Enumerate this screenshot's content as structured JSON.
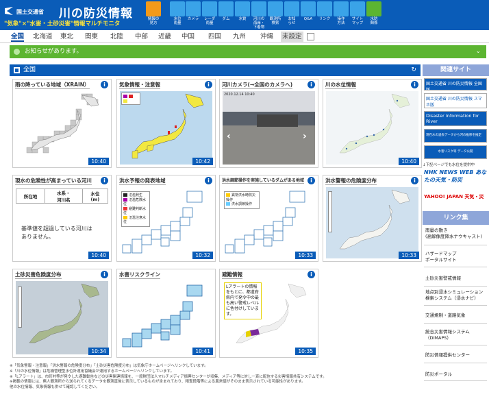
{
  "header": {
    "org": "国土交通省",
    "title": "川の防災情報",
    "subtitle": "\"気象\"×\"水害・土砂災害\"情報マルチモニタ",
    "icons": [
      {
        "name": "info-icon",
        "label": "情報の\n見方",
        "color": "#f39a1a"
      },
      {
        "name": "water-level-icon",
        "label": "水位\n雨量",
        "color": "#3aa3e8"
      },
      {
        "name": "camera-icon",
        "label": "カメラ",
        "color": "#3aa3e8"
      },
      {
        "name": "radar-icon",
        "label": "レーダ\n雨量",
        "color": "#3aa3e8"
      },
      {
        "name": "dam-icon",
        "label": "ダム",
        "color": "#3aa3e8"
      },
      {
        "name": "water-quality-icon",
        "label": "水質",
        "color": "#3aa3e8"
      },
      {
        "name": "river-search-icon",
        "label": "河川の\n海岸・\n下着物",
        "color": "#3aa3e8"
      },
      {
        "name": "observatory-icon",
        "label": "観測所\n検索",
        "color": "#3aa3e8"
      },
      {
        "name": "notice-icon",
        "label": "お知\nらせ",
        "color": "#3aa3e8"
      },
      {
        "name": "qa-icon",
        "label": "Q&A",
        "color": "#3aa3e8"
      },
      {
        "name": "link-icon",
        "label": "リンク",
        "color": "#3aa3e8"
      },
      {
        "name": "operation-icon",
        "label": "操作\n方法",
        "color": "#3aa3e8"
      },
      {
        "name": "sitemap-icon",
        "label": "サイト\nマップ",
        "color": "#3aa3e8"
      },
      {
        "name": "disaster-icon",
        "label": "水防\n関係",
        "color": "#5cb531"
      }
    ]
  },
  "regions": [
    "全国",
    "北海道",
    "東北",
    "関東",
    "北陸",
    "中部",
    "近畿",
    "中国",
    "四国",
    "九州",
    "沖縄",
    "未設定"
  ],
  "notice": {
    "text": "お知らせがあります。"
  },
  "section": {
    "title": "全国"
  },
  "cards": [
    {
      "title": "雨の降っている地域（XRAIN）",
      "time": "10:40"
    },
    {
      "title": "気象情報・注意報",
      "time": "10:42"
    },
    {
      "title": "河川カメラ(→全国のカメラへ)",
      "time": "",
      "camera_date": "2020.12.14 10:40"
    },
    {
      "title": "川の水位情報",
      "time": "10:40"
    },
    {
      "title": "現水の危険性が高まっている河川",
      "time": "10:40",
      "col1": "所在地",
      "col2": "水系・\n河川名",
      "col3": "水位\n(m)",
      "message": "基準値を超過している河川は\nありません。"
    },
    {
      "title": "洪水予報の発表地域",
      "time": "10:32",
      "legend": [
        "氾濫発生",
        "氾濫危険水位",
        "避難判断水位",
        "氾濫注意水位"
      ]
    },
    {
      "title": "洪水調節操作を実施しているダムがある地域",
      "time": "10:33",
      "legend": [
        "異常洪水時防災操作",
        "洪水調節操作"
      ]
    },
    {
      "title": "洪水警報の危険度分布",
      "time": "10:33"
    },
    {
      "title": "土砂災害危険度分布",
      "time": "10:34"
    },
    {
      "title": "水害リスクライン",
      "time": "10:41"
    },
    {
      "title": "避難情報",
      "time": "10:35",
      "message": "Lアラートの情報をもとに、都道府県内で発令中の最も高い警戒レベルに色付けしています。"
    }
  ],
  "sidebar": {
    "related_title": "関連サイト",
    "banners": [
      "国土交通省 川の防災情報 全国版",
      "国土交通省 川の防災情報 スマホ版",
      "Disaster Information for River",
      "現在水の過去データから河の推移を推定",
      "水害リスク等 データ公開"
    ],
    "note": "↓下記ページでも水位を提供中",
    "nhk": "NHK NEWS WEB あなたの天気・防災",
    "yahoo": "YAHOO! JAPAN 天気・災害",
    "links_title": "リンク集",
    "links": [
      "雨量の動き\n(高解像度降水ナウキャスト)",
      "ハザードマップ\nポータルサイト",
      "土砂災害警戒情報",
      "地点別浸水シミュレーション\n検索システム（浸水ナビ）",
      "交通規制・道路気象",
      "統合災害情報システム\n（DiMAPS）",
      "防災情報提供センター",
      "防災ポータル"
    ]
  },
  "footer": [
    "※「気象警報・注意報」「洪水警報の危険度分布」「土砂災害危険度分布」は気象庁ホームページへリンクしています。",
    "※「川の水位情報」は危機管理型水位計運用協議会が運用するホームページへリンクしています。",
    "※「Lアラート」は、市町村等が発令した避難勧告などの災害関連情報を、一般財団法人マルチメディア振興センターが収集、メディア等に対し一斉に配信する災害情報共有システムです。",
    "※掲載の情報には、無人観測所から送られてくるデータを観測直後に表示しているものが含まれており、精査段階等による異常値がそのまま表示されている可能性があります。",
    "他の水位情報、気象情報も併せて確認してください。"
  ]
}
